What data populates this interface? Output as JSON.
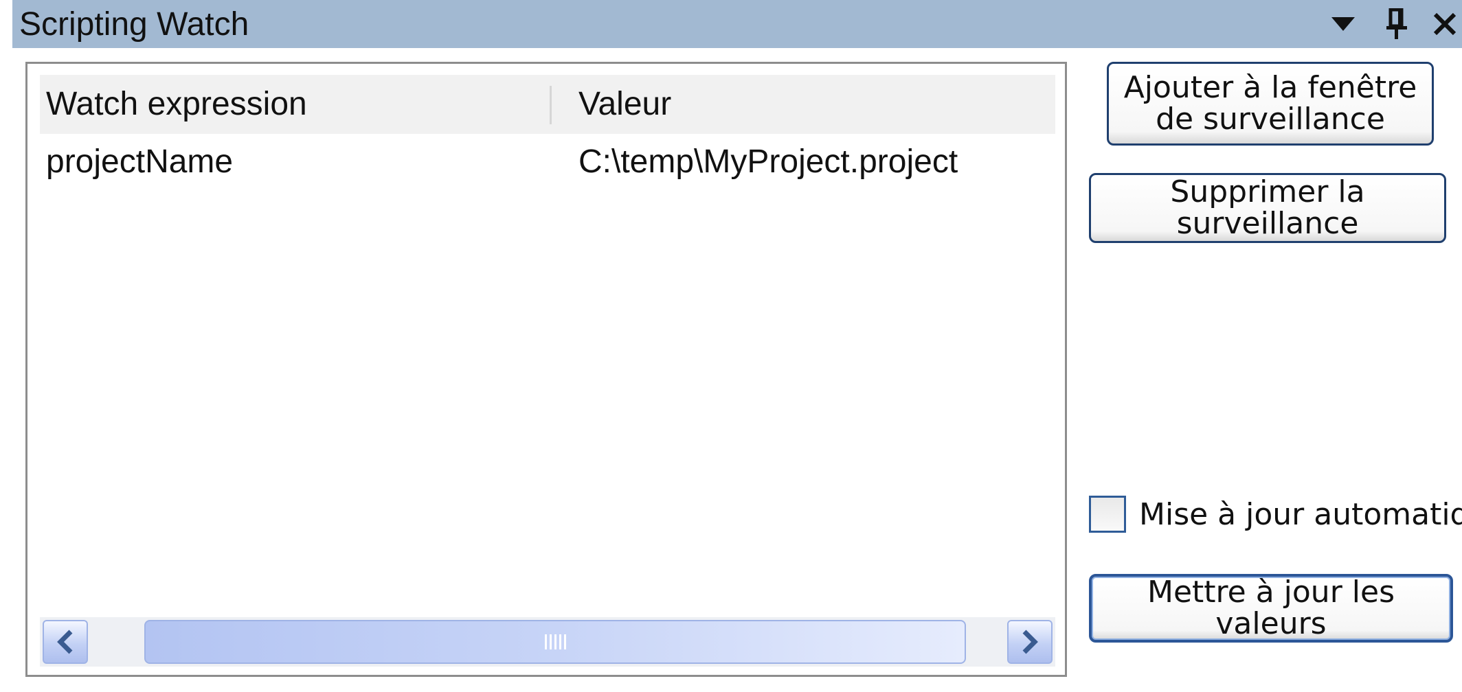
{
  "window": {
    "title": "Scripting Watch",
    "icons": [
      "dropdown-arrow-icon",
      "pin-icon",
      "close-icon"
    ]
  },
  "grid": {
    "columns": [
      "Watch expression",
      "Valeur"
    ],
    "rows": [
      {
        "expression": "projectName",
        "value": "C:\\temp\\MyProject.project"
      }
    ]
  },
  "buttons": {
    "add_watch": "Ajouter à la fenêtre de surveillance",
    "remove_watch": "Supprimer la surveillance",
    "refresh_values": "Mettre à jour les valeurs"
  },
  "auto_update": {
    "label": "Mise à jour automatique",
    "checked": false
  },
  "colors": {
    "titlebar": "#a2b9d2",
    "button_border": "#1f3f6e",
    "scroll_accent": "#9fb3e6"
  }
}
